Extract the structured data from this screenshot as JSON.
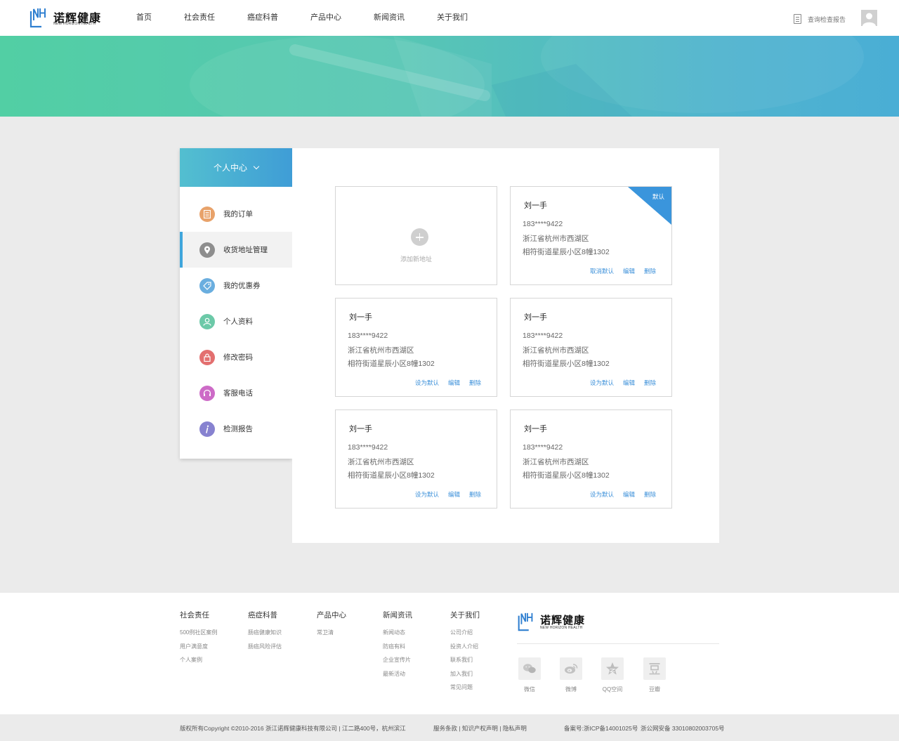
{
  "brand": {
    "name_cn": "诺辉健康",
    "name_en": "NEW HORIZON HEALTH",
    "mark": "NH",
    "accent": "#3a95dc"
  },
  "nav": {
    "items": [
      "首页",
      "社会责任",
      "癌症科普",
      "产品中心",
      "新闻资讯",
      "关于我们"
    ]
  },
  "header": {
    "report_link": "查询检查报告",
    "report_icon": "document-icon",
    "avatar_icon": "user-avatar-icon"
  },
  "sidebar": {
    "title": "个人中心",
    "items": [
      {
        "label": "我的订单",
        "icon": "order-list-icon",
        "color": "#e8a26a"
      },
      {
        "label": "收货地址管理",
        "icon": "location-pin-icon",
        "color": "#8e8e8e",
        "active": true
      },
      {
        "label": "我的优惠券",
        "icon": "coupon-tag-icon",
        "color": "#6aaedf"
      },
      {
        "label": "个人资料",
        "icon": "person-icon",
        "color": "#6cc9a8"
      },
      {
        "label": "修改密码",
        "icon": "lock-icon",
        "color": "#e36f6f"
      },
      {
        "label": "客服电话",
        "icon": "headset-icon",
        "color": "#cd6bc7"
      },
      {
        "label": "检测报告",
        "icon": "info-icon",
        "color": "#8782d0"
      }
    ]
  },
  "add_card": {
    "label": "添加新地址"
  },
  "addresses": [
    {
      "name": "刘一手",
      "phone": "183****9422",
      "region": "浙江省杭州市西湖区",
      "street": "相符街道星辰小区8幢1302",
      "is_default": true,
      "badge": "默认",
      "actions": [
        "取消默认",
        "编辑",
        "删除"
      ]
    },
    {
      "name": "刘一手",
      "phone": "183****9422",
      "region": "浙江省杭州市西湖区",
      "street": "相符街道星辰小区8幢1302",
      "is_default": false,
      "actions": [
        "设为默认",
        "编辑",
        "删除"
      ]
    },
    {
      "name": "刘一手",
      "phone": "183****9422",
      "region": "浙江省杭州市西湖区",
      "street": "相符街道星辰小区8幢1302",
      "is_default": false,
      "actions": [
        "设为默认",
        "编辑",
        "删除"
      ]
    },
    {
      "name": "刘一手",
      "phone": "183****9422",
      "region": "浙江省杭州市西湖区",
      "street": "相符街道星辰小区8幢1302",
      "is_default": false,
      "actions": [
        "设为默认",
        "编辑",
        "删除"
      ]
    },
    {
      "name": "刘一手",
      "phone": "183****9422",
      "region": "浙江省杭州市西湖区",
      "street": "相符街道星辰小区8幢1302",
      "is_default": false,
      "actions": [
        "设为默认",
        "编辑",
        "删除"
      ]
    }
  ],
  "footer": {
    "columns": [
      {
        "title": "社会责任",
        "links": [
          "500例社区案例",
          "用户满意度",
          "个人案例"
        ]
      },
      {
        "title": "癌症科普",
        "links": [
          "肠癌健康知识",
          "肠癌风险评估"
        ]
      },
      {
        "title": "产品中心",
        "links": [
          "常卫清"
        ]
      },
      {
        "title": "新闻资讯",
        "links": [
          "新闻动态",
          "防癌有料",
          "企业宣传片",
          "最新活动"
        ]
      },
      {
        "title": "关于我们",
        "links": [
          "公司介绍",
          "投资人介绍",
          "联系我们",
          "加入我们",
          "常见问题"
        ]
      }
    ],
    "social": [
      {
        "label": "微信",
        "icon": "wechat-icon"
      },
      {
        "label": "微博",
        "icon": "weibo-icon"
      },
      {
        "label": "QQ空间",
        "icon": "qzone-star-icon"
      },
      {
        "label": "豆瓣",
        "icon": "douban-icon"
      }
    ]
  },
  "bottom_bar": {
    "copyright": "版权所有Copyright ©2010-2016    浙江诺辉健康科技有限公司  |  江二路400号，杭州滨江",
    "links": "服务条款 | 知识产权声明 | 隐私声明",
    "icp": "备案号:浙ICP备14001025号",
    "police": "浙公网安备 33010802003705号"
  }
}
